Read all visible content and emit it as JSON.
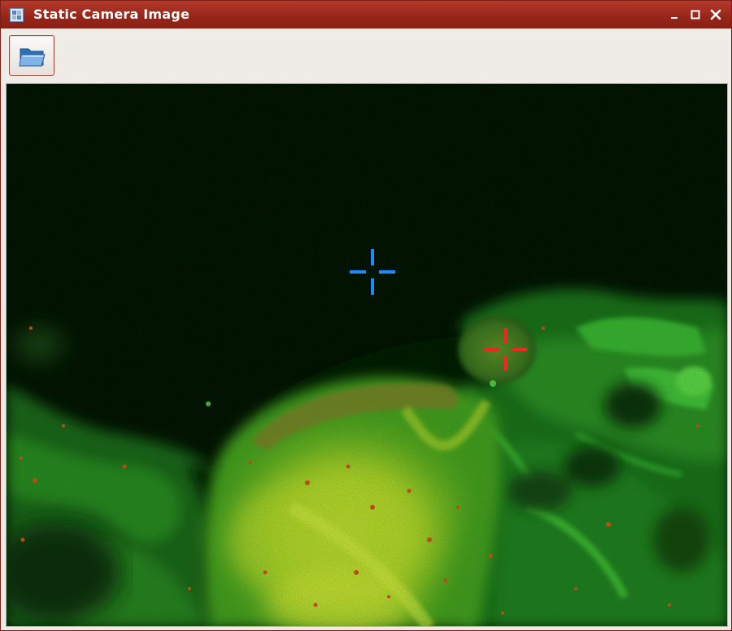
{
  "window": {
    "title": "Static Camera Image",
    "icon": "image-app-icon",
    "controls": [
      "minimize-icon",
      "maximize-icon",
      "close-icon"
    ]
  },
  "toolbar": {
    "open_button_icon": "open-folder-icon"
  },
  "image": {
    "description_colors": {
      "background": "#000000",
      "fluorescence_green": "#3fd23a",
      "fluorescence_yellow": "#d8e632",
      "speckle_red": "#e03a1c"
    },
    "markers": [
      {
        "name": "blue-crosshair",
        "color": "#1a8cff"
      },
      {
        "name": "red-crosshair",
        "color": "#ff2020"
      }
    ]
  }
}
